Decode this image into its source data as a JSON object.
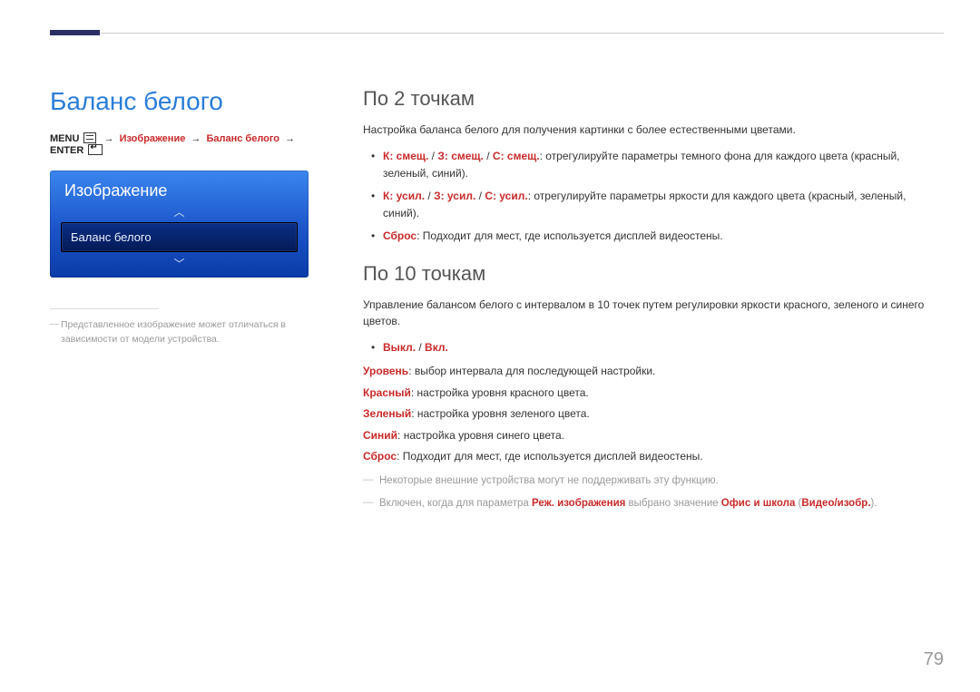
{
  "title": "Баланс белого",
  "breadcrumb": {
    "menu": "MENU",
    "p1": "Изображение",
    "p2": "Баланс белого",
    "enter": "ENTER"
  },
  "osd": {
    "header": "Изображение",
    "item": "Баланс белого",
    "chev_up": "︿",
    "chev_down": "﹀"
  },
  "left_footnote": "Представленное изображение может отличаться в зависимости от модели устройства.",
  "sec1": {
    "heading": "По 2 точкам",
    "intro": "Настройка баланса белого для получения картинки с более естественными цветами.",
    "b1_red": "К: смещ.",
    "b1_sep": " / ",
    "b1_red2": "З: смещ.",
    "b1_red3": "С: смещ.",
    "b1_text": ": отрегулируйте параметры темного фона для каждого цвета (красный, зеленый, синий).",
    "b2_red": "К: усил.",
    "b2_red2": "З: усил.",
    "b2_red3": "С: усил.",
    "b2_text": ": отрегулируйте параметры яркости для каждого цвета (красный, зеленый, синий).",
    "b3_red": "Сброс",
    "b3_text": ": Подходит для мест, где используется дисплей видеостены."
  },
  "sec2": {
    "heading": "По 10 точкам",
    "intro": "Управление балансом белого с интервалом в 10 точек путем регулировки яркости красного, зеленого и синего цветов.",
    "b_off": "Выкл.",
    "b_slash": " / ",
    "b_on": "Вкл.",
    "d1_k": "Уровень",
    "d1_v": ": выбор интервала для последующей настройки.",
    "d2_k": "Красный",
    "d2_v": ": настройка уровня красного цвета.",
    "d3_k": "Зеленый",
    "d3_v": ": настройка уровня зеленого цвета.",
    "d4_k": "Синий",
    "d4_v": ": настройка уровня синего цвета.",
    "d5_k": "Сброс",
    "d5_v": ": Подходит для мест, где используется дисплей видеостены.",
    "note1": "Некоторые внешние устройства могут не поддерживать эту функцию.",
    "note2_a": "Включен, когда для параметра ",
    "note2_b": "Реж. изображения",
    "note2_c": " выбрано значение ",
    "note2_d": "Офис и школа",
    "note2_e": " (",
    "note2_f": "Видео/изобр.",
    "note2_g": ")."
  },
  "page": "79"
}
